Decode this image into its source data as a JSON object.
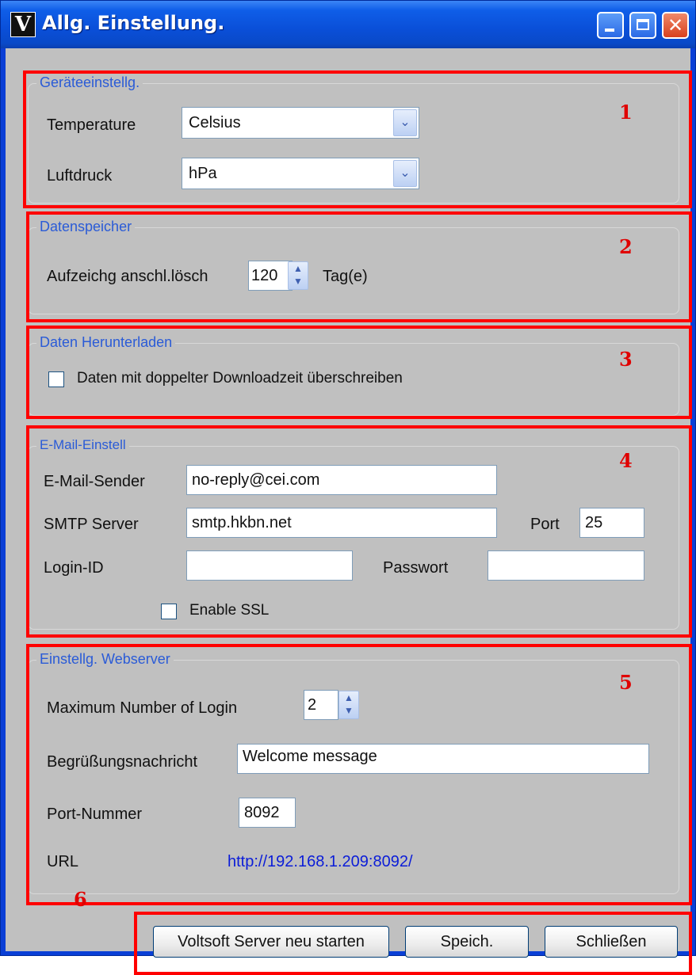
{
  "window": {
    "app_icon_letter": "V",
    "title": "Allg. Einstellung.",
    "minimize_icon": "minimize-icon",
    "maximize_icon": "maximize-icon",
    "close_glyph": "✕"
  },
  "annotations": [
    "1",
    "2",
    "3",
    "4",
    "5",
    "6"
  ],
  "device": {
    "title": "Geräteeinstellg.",
    "temperature_label": "Temperature",
    "temperature_value": "Celsius",
    "pressure_label": "Luftdruck",
    "pressure_value": "hPa",
    "arrow_glyph": "⌄"
  },
  "storage": {
    "title": "Datenspeicher",
    "delete_label": "Aufzeichg anschl.lösch",
    "delete_value": "120",
    "unit": "Tag(e)"
  },
  "download": {
    "title": "Daten Herunterladen",
    "overwrite_label": "Daten mit doppelter Downloadzeit überschreiben"
  },
  "email": {
    "title": "E-Mail-Einstell",
    "sender_label": "E-Mail-Sender",
    "sender_value": "no-reply@cei.com",
    "smtp_label": "SMTP Server",
    "smtp_value": "smtp.hkbn.net",
    "port_label": "Port",
    "port_value": "25",
    "login_label": "Login-ID",
    "login_value": "",
    "password_label": "Passwort",
    "password_value": "",
    "ssl_label": "Enable SSL"
  },
  "webserver": {
    "title": "Einstellg. Webserver",
    "max_login_label": "Maximum Number of Login",
    "max_login_value": "2",
    "welcome_label": "Begrüßungsnachricht",
    "welcome_value": "Welcome message",
    "port_label": "Port-Nummer",
    "port_value": "8092",
    "url_label": "URL",
    "url_value": "http://192.168.1.209:8092/"
  },
  "buttons": {
    "restart": "Voltsoft Server neu starten",
    "save": "Speich.",
    "close": "Schließen"
  }
}
